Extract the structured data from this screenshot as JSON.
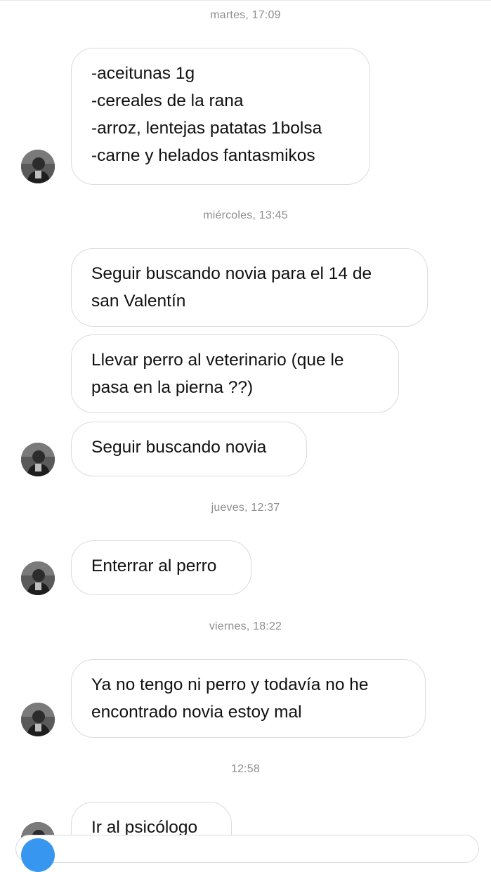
{
  "conversation": {
    "groups": [
      {
        "timestamp": "martes, 17:09",
        "messages": [
          {
            "lines": [
              "-aceitunas 1g",
              "-cereales de la rana",
              "-arroz, lentejas patatas 1bolsa",
              "-carne y helados fantasmikos"
            ]
          }
        ]
      },
      {
        "timestamp": "miércoles, 13:45",
        "messages": [
          {
            "lines": [
              "Seguir buscando novia para el 14 de",
              "san Valentín"
            ]
          },
          {
            "lines": [
              "Llevar perro al veterinario (que le",
              "pasa en la pierna ??)"
            ]
          },
          {
            "lines": [
              "Seguir buscando novia"
            ]
          }
        ]
      },
      {
        "timestamp": "jueves, 12:37",
        "messages": [
          {
            "lines": [
              "Enterrar al perro"
            ]
          }
        ]
      },
      {
        "timestamp": "viernes, 18:22",
        "messages": [
          {
            "lines": [
              "Ya no tengo ni perro y todavía no he",
              "encontrado novia estoy mal"
            ]
          }
        ]
      },
      {
        "timestamp": "12:58",
        "messages": [
          {
            "lines": [
              "Ir al psicólogo"
            ]
          }
        ]
      }
    ]
  },
  "contact": {
    "avatar_icon": "contact-avatar-photo"
  },
  "composer": {
    "camera_icon": "camera-icon",
    "accent_color": "#3797f0"
  },
  "colors": {
    "bubble_border": "#dbdbdb",
    "timestamp_text": "#8e8e8e",
    "message_text": "#111111"
  }
}
